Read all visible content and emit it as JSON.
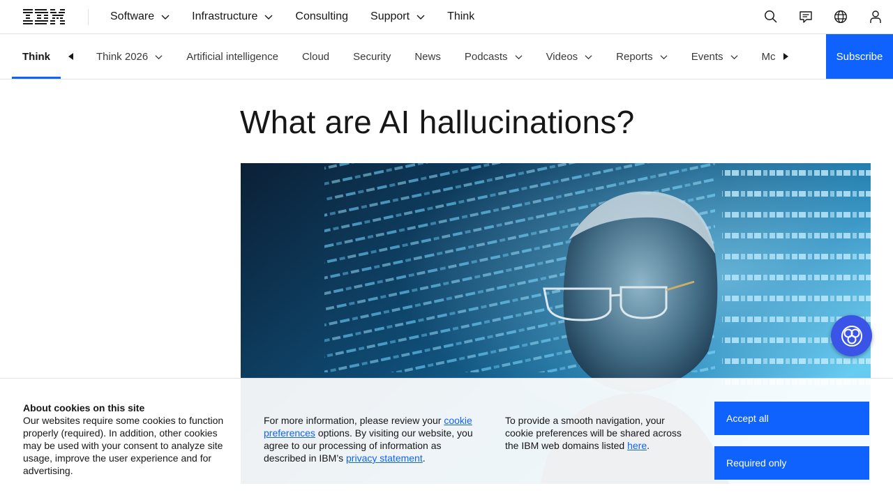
{
  "brand": {
    "logo_text": "IBM"
  },
  "masthead": {
    "nav": [
      {
        "label": "Software",
        "dropdown": true
      },
      {
        "label": "Infrastructure",
        "dropdown": true
      },
      {
        "label": "Consulting",
        "dropdown": false
      },
      {
        "label": "Support",
        "dropdown": true
      },
      {
        "label": "Think",
        "dropdown": false
      }
    ],
    "icons": [
      "search-icon",
      "chat-icon",
      "globe-icon",
      "user-icon"
    ]
  },
  "subnav": {
    "active": "Think",
    "items": [
      {
        "label": "Think 2026",
        "dropdown": true
      },
      {
        "label": "Artificial intelligence",
        "dropdown": false
      },
      {
        "label": "Cloud",
        "dropdown": false
      },
      {
        "label": "Security",
        "dropdown": false
      },
      {
        "label": "News",
        "dropdown": false
      },
      {
        "label": "Podcasts",
        "dropdown": true
      },
      {
        "label": "Videos",
        "dropdown": true
      },
      {
        "label": "Reports",
        "dropdown": true
      },
      {
        "label": "Events",
        "dropdown": true
      },
      {
        "label": "Mc",
        "dropdown": false
      }
    ],
    "subscribe_label": "Subscribe"
  },
  "article": {
    "title": "What are AI hallucinations?"
  },
  "cookie": {
    "heading": "About cookies on this site",
    "body1": "Our websites require some cookies to function properly (required). In addition, other cookies may be used with your consent to analyze site usage, improve the user experience and for advertising.",
    "body2_pre": "For more information, please review your ",
    "body2_link1": "cookie preferences",
    "body2_mid": " options. By visiting our website, you agree to our processing of information as described in IBM’s ",
    "body2_link2": "privacy statement",
    "body2_post": ".",
    "body3_pre": "To provide a smooth navigation, your cookie preferences will be shared across the IBM web domains listed ",
    "body3_link": "here",
    "body3_post": ".",
    "accept_label": "Accept all",
    "required_label": "Required only"
  },
  "colors": {
    "accent": "#0f62fe",
    "assistant": "#3b54e8"
  }
}
